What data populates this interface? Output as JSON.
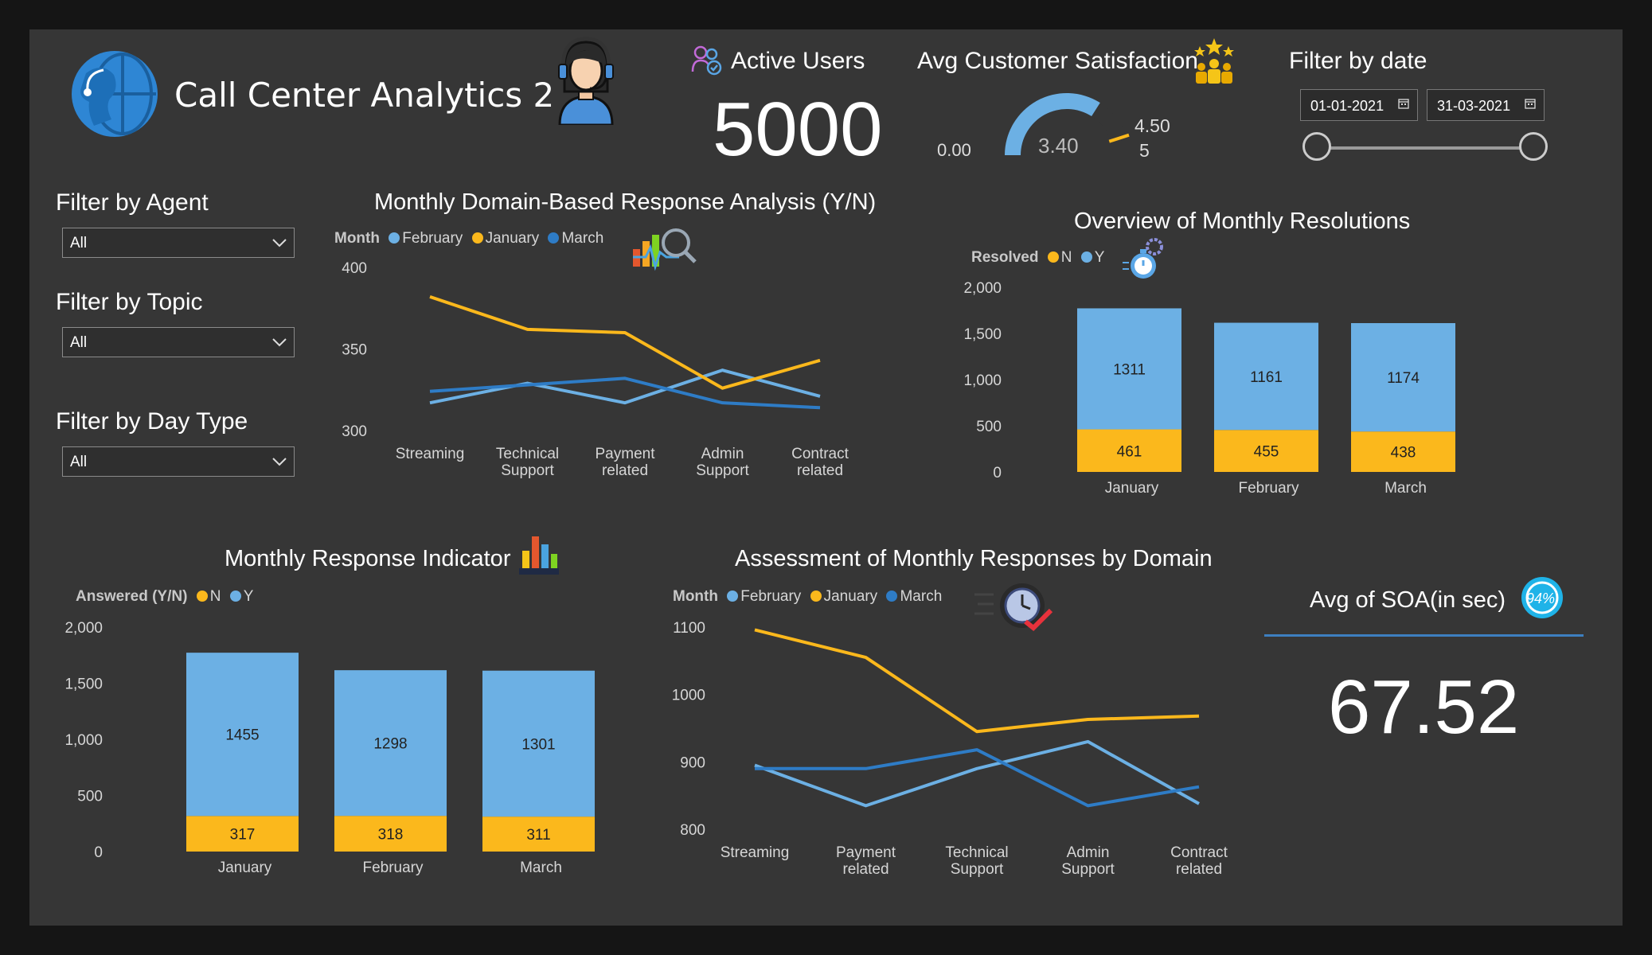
{
  "header": {
    "title": "Call Center Analytics 2"
  },
  "kpis": {
    "active_users_label": "Active Users",
    "active_users_value": "5000",
    "satisfaction_label": "Avg Customer Satisfaction",
    "satisfaction": {
      "min_label": "0.00",
      "value_label": "3.40",
      "target_label": "4.50",
      "max_label": "5",
      "value": 3.4,
      "target": 4.5,
      "min": 0,
      "max": 5
    },
    "soa_label": "Avg of SOA(in sec)",
    "soa_value": "67.52",
    "soa_badge": "94%"
  },
  "filters": {
    "date_label": "Filter by date",
    "date_start": "01-01-2021",
    "date_end": "31-03-2021",
    "agent_label": "Filter by Agent",
    "agent_value": "All",
    "topic_label": "Filter by Topic",
    "topic_value": "All",
    "daytype_label": "Filter by Day Type",
    "daytype_value": "All"
  },
  "colors": {
    "february": "#6cb0e4",
    "january": "#fbb81c",
    "march": "#2e7cc6",
    "n": "#fbb81c",
    "y": "#6cb0e4",
    "accent": "#2e8ad6"
  },
  "chart_data": [
    {
      "id": "domain_response",
      "type": "line",
      "title": "Monthly Domain-Based Response Analysis (Y/N)",
      "legend_title": "Month",
      "legend_placement": "top-left",
      "categories": [
        "Streaming",
        "Technical Support",
        "Payment related",
        "Admin Support",
        "Contract related"
      ],
      "series": [
        {
          "name": "February",
          "values": [
            317,
            329,
            317,
            337,
            321
          ]
        },
        {
          "name": "January",
          "values": [
            382,
            362,
            360,
            326,
            343
          ]
        },
        {
          "name": "March",
          "values": [
            324,
            328,
            332,
            317,
            314
          ]
        }
      ],
      "ylim": [
        300,
        400
      ],
      "yticks": [
        "300",
        "350",
        "400"
      ]
    },
    {
      "id": "monthly_resolutions",
      "type": "bar",
      "title": "Overview of Monthly Resolutions",
      "legend_title": "Resolved",
      "legend_placement": "top-left",
      "stacked": true,
      "categories": [
        "January",
        "February",
        "March"
      ],
      "series": [
        {
          "name": "N",
          "values": [
            461,
            455,
            438
          ]
        },
        {
          "name": "Y",
          "values": [
            1311,
            1161,
            1174
          ]
        }
      ],
      "ylim": [
        0,
        2000
      ],
      "yticks": [
        "0",
        "500",
        "1,000",
        "1,500",
        "2,000"
      ]
    },
    {
      "id": "response_indicator",
      "type": "bar",
      "title": "Monthly Response Indicator",
      "legend_title": "Answered (Y/N)",
      "legend_placement": "top-left",
      "stacked": true,
      "categories": [
        "January",
        "February",
        "March"
      ],
      "series": [
        {
          "name": "N",
          "values": [
            317,
            318,
            311
          ]
        },
        {
          "name": "Y",
          "values": [
            1455,
            1298,
            1301
          ]
        }
      ],
      "ylim": [
        0,
        2000
      ],
      "yticks": [
        "0",
        "500",
        "1,000",
        "1,500",
        "2,000"
      ]
    },
    {
      "id": "responses_by_domain",
      "type": "line",
      "title": "Assessment of Monthly Responses by Domain",
      "legend_title": "Month",
      "legend_placement": "top-left",
      "categories": [
        "Streaming",
        "Payment related",
        "Technical Support",
        "Admin Support",
        "Contract related"
      ],
      "series": [
        {
          "name": "February",
          "values": [
            895,
            835,
            890,
            930,
            838
          ]
        },
        {
          "name": "January",
          "values": [
            1096,
            1055,
            945,
            963,
            968
          ]
        },
        {
          "name": "March",
          "values": [
            890,
            890,
            918,
            835,
            863
          ]
        }
      ],
      "ylim": [
        800,
        1100
      ],
      "yticks": [
        "800",
        "900",
        "1000",
        "1100"
      ]
    }
  ]
}
